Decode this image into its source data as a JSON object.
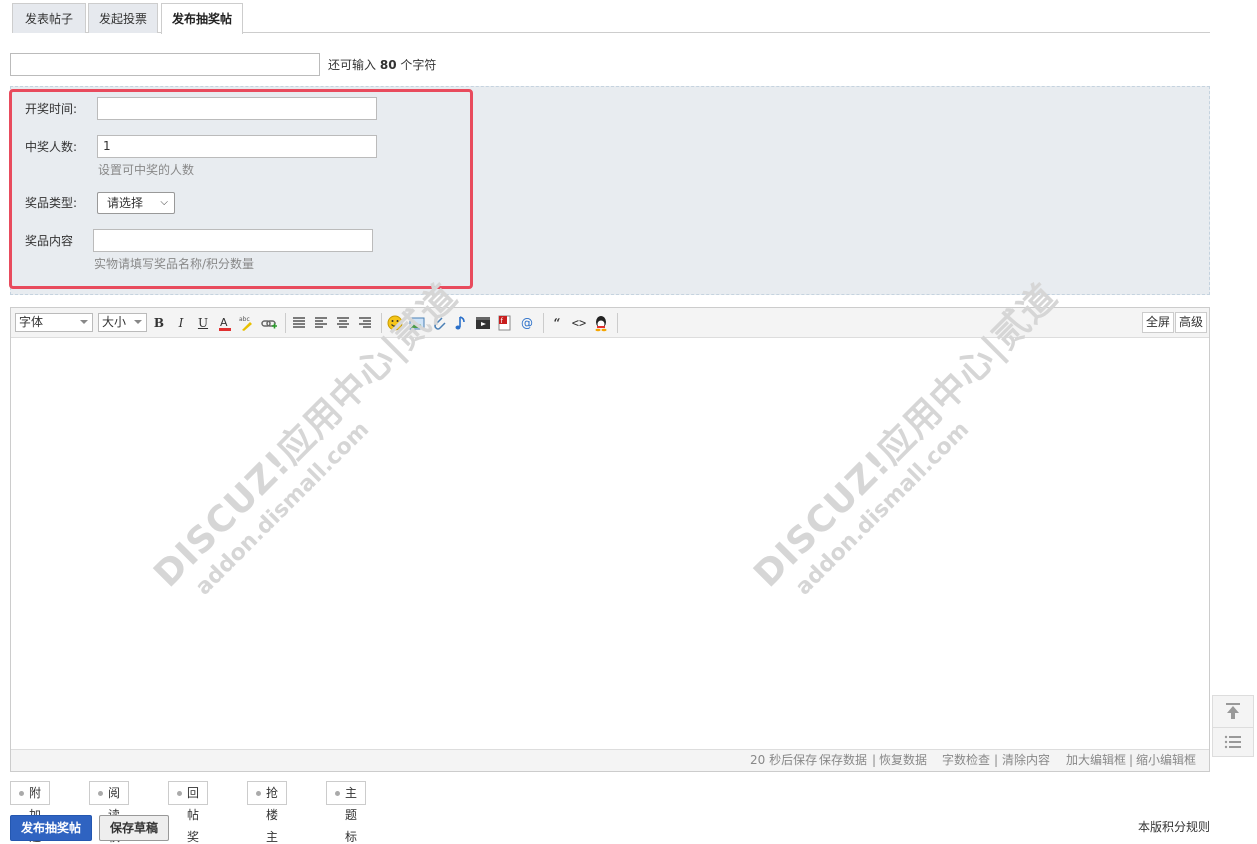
{
  "tabs": [
    {
      "label": "发表帖子",
      "active": false
    },
    {
      "label": "发起投票",
      "active": false
    },
    {
      "label": "发布抽奖帖",
      "active": true
    }
  ],
  "title": {
    "value": "",
    "remain_prefix": "还可输入",
    "remain_count": "80",
    "remain_suffix": "个字符"
  },
  "lottery": {
    "draw_time_label": "开奖时间:",
    "draw_time_value": "",
    "winners_label": "中奖人数:",
    "winners_value": "1",
    "winners_hint": "设置可中奖的人数",
    "prize_type_label": "奖品类型:",
    "prize_type_selected": "请选择",
    "prize_content_label": "奖品内容",
    "prize_content_value": "",
    "prize_content_hint": "实物请填写奖品名称/积分数量"
  },
  "toolbar": {
    "font_label": "字体",
    "size_label": "大小",
    "fullscreen_label": "全屏",
    "advanced_label": "高级"
  },
  "status": {
    "autosave": "20 秒后保存",
    "save_data": "保存数据",
    "restore_data": "恢复数据",
    "char_check": "字数检查",
    "clear": "清除内容",
    "enlarge": "加大编辑框",
    "shrink": "缩小编辑框",
    "sep": "|"
  },
  "watermark": {
    "brand": "DISCUZ!应用中心|贰道",
    "url": "addon.dismall.com",
    "reg": "®"
  },
  "options": [
    {
      "label": "附加选项"
    },
    {
      "label": "阅读权限"
    },
    {
      "label": "回帖奖励"
    },
    {
      "label": "抢楼主题"
    },
    {
      "label": "主题标签"
    }
  ],
  "actions": {
    "submit_label": "发布抽奖帖",
    "draft_label": "保存草稿",
    "rules_label": "本版积分规则"
  },
  "colors": {
    "accent": "#2f63c1",
    "highlight_border": "#e84b5d",
    "panel_bg": "#e8ecf0"
  }
}
